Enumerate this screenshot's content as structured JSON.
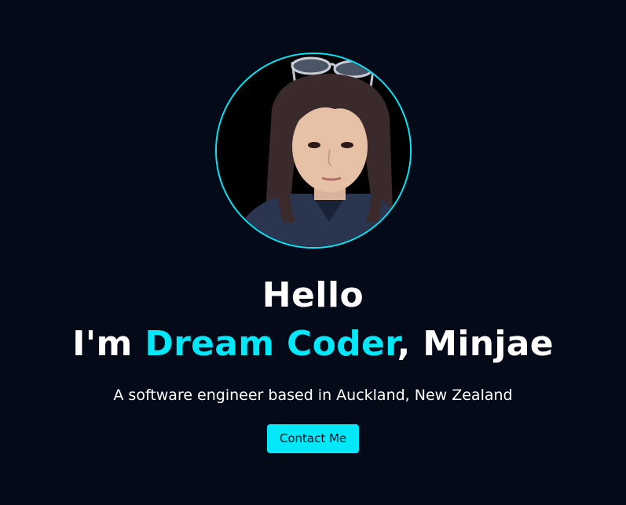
{
  "theme": {
    "background": "#050a18",
    "accent": "#03e8f9",
    "text": "#ffffff"
  },
  "avatar": {
    "icon": "profile-photo"
  },
  "hero": {
    "greeting": "Hello",
    "intro_prefix": "I'm ",
    "intro_highlight": "Dream Coder",
    "intro_suffix": ", Minjae",
    "description": "A software engineer based in Auckland, New Zealand",
    "contact_label": "Contact Me"
  }
}
